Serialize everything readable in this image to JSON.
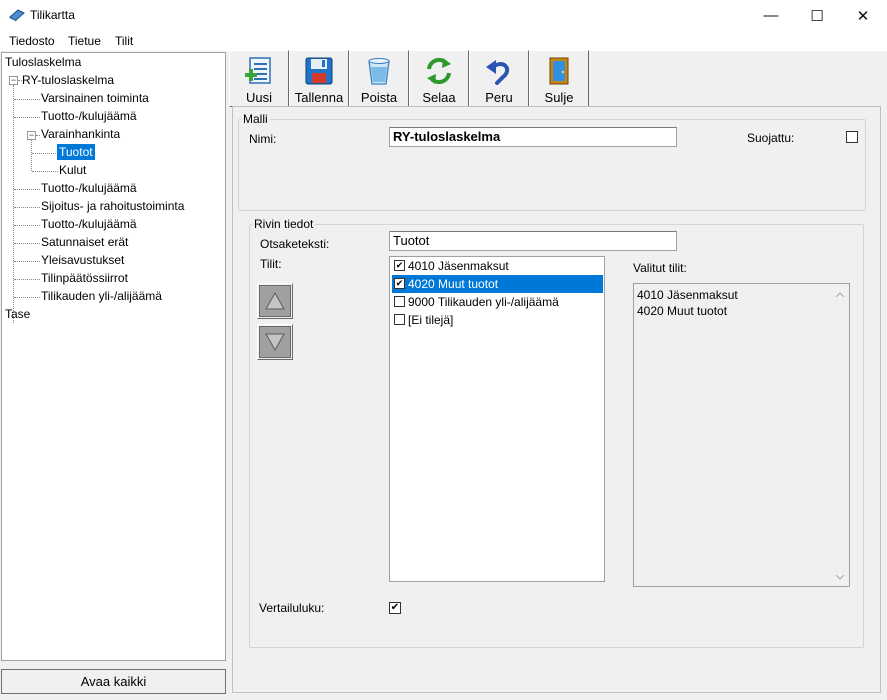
{
  "window": {
    "title": "Tilikartta",
    "app_icon": "book-icon",
    "controls": {
      "minimize": "—",
      "maximize": "☐",
      "close": "✕"
    }
  },
  "menu": {
    "file": "Tiedosto",
    "record": "Tietue",
    "accounts": "Tilit"
  },
  "tree": {
    "root": "Tuloslaskelma",
    "ry": "RY-tuloslaskelma",
    "varsinainen": "Varsinainen toiminta",
    "tk1": "Tuotto-/kulujäämä",
    "varainhankinta": "Varainhankinta",
    "tuotot": "Tuotot",
    "kulut": "Kulut",
    "tk2": "Tuotto-/kulujäämä",
    "sijoitus": "Sijoitus- ja rahoitustoiminta",
    "tk3": "Tuotto-/kulujäämä",
    "satunnaiset": "Satunnaiset erät",
    "yleisavustukset": "Yleisavustukset",
    "tilinpaatos": "Tilinpäätössiirrot",
    "tilikauden": "Tilikauden yli-/alijäämä",
    "tase": "Tase",
    "toggle_expanded": "−"
  },
  "expand_all": "Avaa kaikki",
  "toolbar": {
    "new": "Uusi",
    "save": "Tallenna",
    "delete": "Poista",
    "browse": "Selaa",
    "cancel": "Peru",
    "close": "Sulje"
  },
  "malli": {
    "legend": "Malli",
    "name_label": "Nimi:",
    "name_value": "RY-tuloslaskelma",
    "protected_label": "Suojattu:",
    "protected_checked": false
  },
  "rivi": {
    "legend": "Rivin tiedot",
    "header_label": "Otsaketeksti:",
    "header_value": "Tuotot",
    "accounts_label": "Tilit:",
    "accounts": [
      {
        "label": "4010 Jäsenmaksut",
        "checked": true
      },
      {
        "label": "4020 Muut tuotot",
        "checked": true
      },
      {
        "label": "9000 Tilikauden yli-/alijäämä",
        "checked": false
      },
      {
        "label": "[Ei tilejä]",
        "checked": false
      }
    ],
    "selected_label": "Valitut tilit:",
    "selected_text": "4010 Jäsenmaksut\n4020 Muut tuotot",
    "compare_label": "Vertailuluku:",
    "compare_checked": true,
    "check_mark": "✔"
  },
  "colors": {
    "selection": "#0078d7",
    "background": "#f0f0f0"
  }
}
